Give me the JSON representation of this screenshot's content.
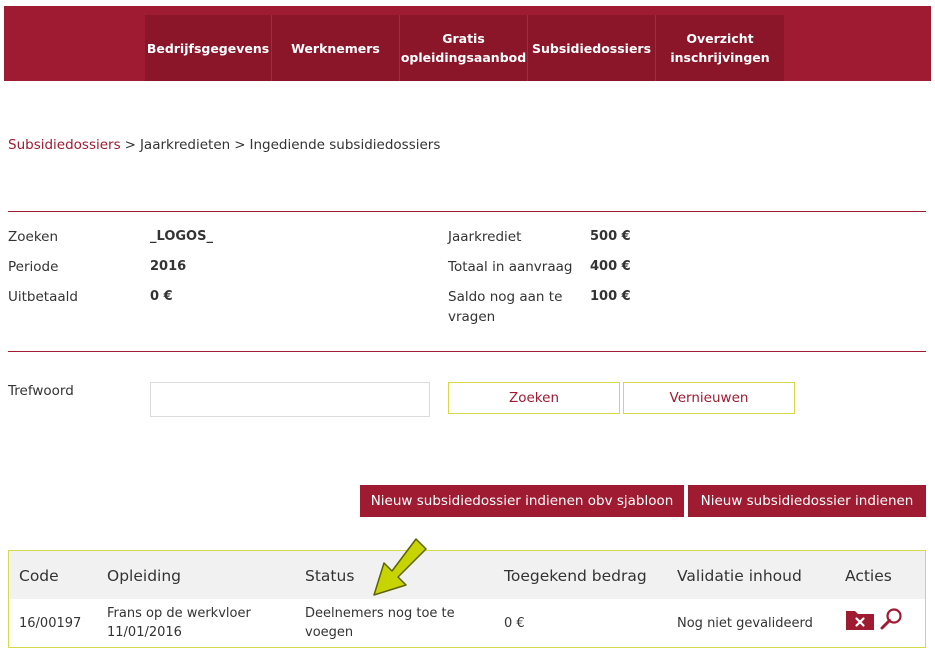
{
  "nav": {
    "items": [
      {
        "label": "Bedrijfsgegevens"
      },
      {
        "label": "Werknemers"
      },
      {
        "label": "Gratis opleidingsaanbod"
      },
      {
        "label": "Subsidiedossiers"
      },
      {
        "label": "Overzicht inschrijvingen"
      }
    ]
  },
  "breadcrumb": {
    "items": [
      "Subsidiedossiers",
      "Jaarkredieten",
      "Ingediende subsidiedossiers"
    ],
    "separator": ">"
  },
  "info": {
    "left": [
      {
        "label": "Zoeken",
        "value": "_LOGOS_"
      },
      {
        "label": "Periode",
        "value": "2016"
      },
      {
        "label": "Uitbetaald",
        "value": "0 €"
      }
    ],
    "right": [
      {
        "label": "Jaarkrediet",
        "value": "500 €"
      },
      {
        "label": "Totaal in aanvraag",
        "value": "400 €"
      },
      {
        "label": "Saldo nog aan te vragen",
        "value": "100 €"
      }
    ]
  },
  "filter": {
    "label": "Trefwoord",
    "input_value": "",
    "search_label": "Zoeken",
    "refresh_label": "Vernieuwen"
  },
  "buttons": {
    "new_from_template": "Nieuw subsidiedossier indienen obv sjabloon",
    "new": "Nieuw subsidiedossier indienen"
  },
  "table": {
    "columns": [
      "Code",
      "Opleiding",
      "Status",
      "Toegekend bedrag",
      "Validatie inhoud",
      "Acties"
    ],
    "rows": [
      {
        "code": "16/00197",
        "opleiding": "Frans op de werkvloer",
        "datum": "11/01/2016",
        "status": "Deelnemers nog toe te voegen",
        "bedrag": "0 €",
        "validatie": "Nog niet gevalideerd"
      }
    ]
  },
  "icons": {
    "delete": "folder-delete-icon",
    "view": "magnifier-icon",
    "pointer": "arrow-pointer-icon"
  },
  "colors": {
    "brand": "#9e1b32",
    "nav_item": "#8c1629",
    "accent_outline": "#d8d84a",
    "arrow": "#c8d400",
    "table_header": "#f1f1f1"
  }
}
